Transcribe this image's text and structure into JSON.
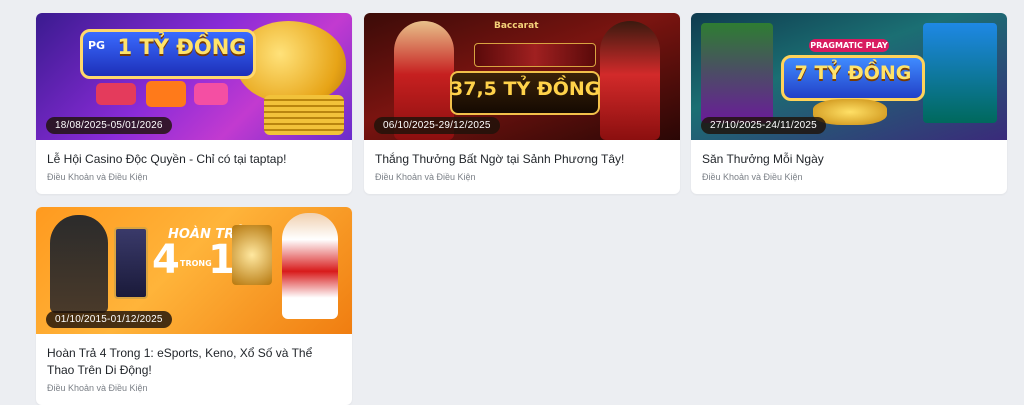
{
  "cards": [
    {
      "date": "18/08/2025-05/01/2026",
      "title": "Lễ Hội Casino Độc Quyền - Chỉ có tại taptap!",
      "terms": "Điều Khoản và Điều Kiện",
      "banner_text": "1 TỶ ĐỒNG",
      "logo_text": "PG"
    },
    {
      "date": "06/10/2025-29/12/2025",
      "title": "Thắng Thưởng Bất Ngờ tại Sảnh Phương Tây!",
      "terms": "Điều Khoản và Điều Kiện",
      "banner_text": "37,5 TỶ ĐỒNG",
      "logo_text": "Baccarat"
    },
    {
      "date": "27/10/2025-24/11/2025",
      "title": "Săn Thưởng Mỗi Ngày",
      "terms": "Điều Khoản và Điều Kiện",
      "banner_text": "7 TỶ ĐỒNG",
      "logo_text": "PRAGMATIC PLAY"
    },
    {
      "date": "01/10/2015-01/12/2025",
      "title": "Hoàn Trả 4 Trong 1: eSports, Keno, Xổ Số và Thể Thao Trên Di Động!",
      "terms": "Điều Khoản và Điều Kiện",
      "banner_text": "HOÀN TRẢ",
      "banner_text_2": "4",
      "banner_text_3": "TRONG",
      "banner_text_4": "1"
    }
  ]
}
